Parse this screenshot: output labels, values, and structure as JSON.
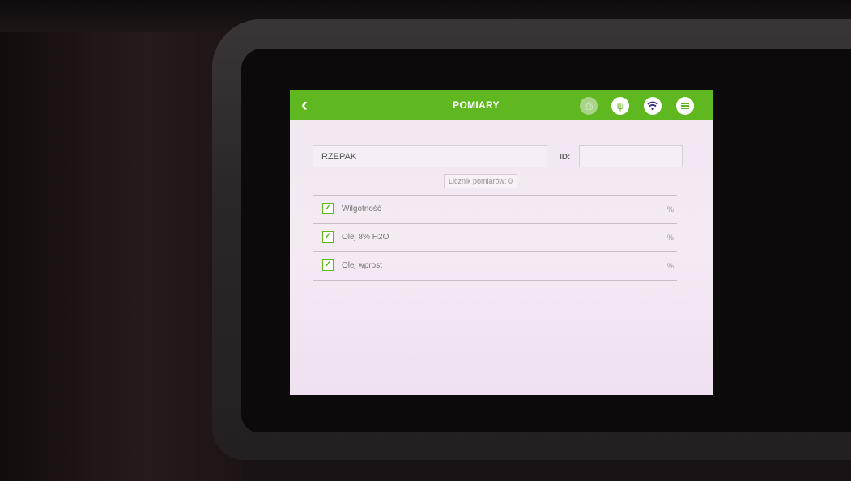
{
  "header": {
    "title": "POMIARY",
    "back_icon": "chevron-left-icon",
    "icons": [
      "printer-icon",
      "usb-icon",
      "wifi-icon",
      "menu-icon"
    ],
    "accent_color": "#5fb81f"
  },
  "sample": {
    "name_value": "RZEPAK",
    "id_label": "ID:",
    "id_value": "",
    "counter_text": "Licznik pomiarów: 0"
  },
  "parameters": [
    {
      "name": "Wilgotność",
      "unit": "%",
      "checked": true
    },
    {
      "name": "Olej 8% H2O",
      "unit": "%",
      "checked": true
    },
    {
      "name": "Olej wprost",
      "unit": "%",
      "checked": true
    }
  ]
}
